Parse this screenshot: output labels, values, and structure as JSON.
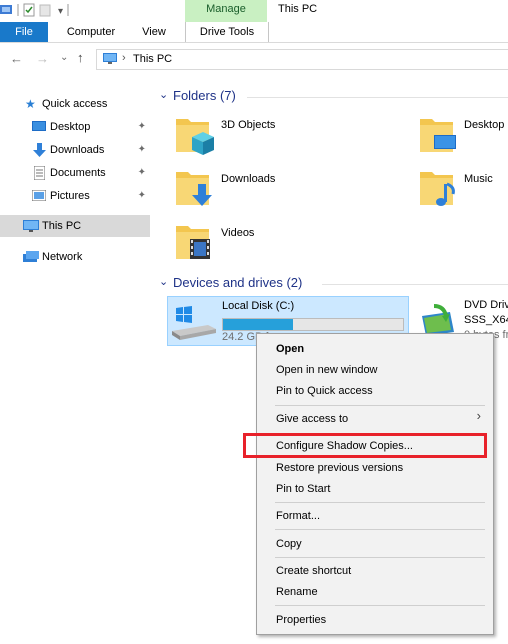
{
  "title_bar": {
    "manage_label": "Manage",
    "window_title": "This PC"
  },
  "ribbon": {
    "tabs": [
      "File",
      "Computer",
      "View",
      "Drive Tools"
    ]
  },
  "address": {
    "path": "This PC"
  },
  "nav_pane": {
    "quick_access": "Quick access",
    "items": [
      "Desktop",
      "Downloads",
      "Documents",
      "Pictures"
    ],
    "this_pc": "This PC",
    "network": "Network"
  },
  "folders": {
    "header": "Folders (7)",
    "items": [
      "3D Objects",
      "Desktop",
      "Downloads",
      "Music",
      "Videos"
    ]
  },
  "devices": {
    "header": "Devices and drives (2)",
    "local_disk": {
      "name": "Local Disk (C:)",
      "free_text": "24.2 GB free of 39.4 GB",
      "used_fraction": 0.39
    },
    "dvd": {
      "name": "DVD Driv",
      "label": "SSS_X64F",
      "free_text": "0 bytes fr"
    }
  },
  "context_menu": {
    "items": [
      "Open",
      "Open in new window",
      "Pin to Quick access",
      "Give access to",
      "Configure Shadow Copies...",
      "Restore previous versions",
      "Pin to Start",
      "Format...",
      "Copy",
      "Create shortcut",
      "Rename",
      "Properties"
    ],
    "highlighted": "Configure Shadow Copies..."
  },
  "colors": {
    "accent": "#1979ca",
    "selection": "#cce8ff",
    "highlight_border": "#e8212a",
    "section_text": "#1e3287"
  }
}
